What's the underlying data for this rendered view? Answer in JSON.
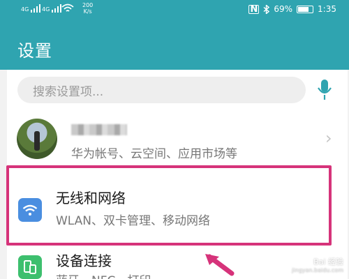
{
  "status_bar": {
    "sim1": "4G",
    "sim2": "4G",
    "speed_value": "200",
    "speed_unit": "K/s",
    "nfc": "N",
    "battery": "69%",
    "battery_level": 0.69,
    "time": "1:35",
    "icons": [
      "signal-icon",
      "signal-icon",
      "wifi-icon",
      "nfc-icon",
      "bluetooth-icon",
      "battery-icon"
    ]
  },
  "header": {
    "title": "设置"
  },
  "search": {
    "placeholder": "搜索设置项..."
  },
  "account": {
    "subtitle": "华为帐号、云空间、应用市场等"
  },
  "settings_items": [
    {
      "title": "无线和网络",
      "subtitle": "WLAN、双卡管理、移动网络",
      "icon": "wifi-icon",
      "icon_color": "#4a8ee0"
    },
    {
      "title": "设备连接",
      "subtitle": "蓝牙、NFC、打印",
      "icon": "device-link-icon",
      "icon_color": "#3dbf6e"
    }
  ],
  "colors": {
    "header": "#2fa4b0",
    "highlight": "#d6337a",
    "mic": "#2fa4b0"
  },
  "watermark": {
    "text": "Bai 经验",
    "sub": "jingyan.baidu.com"
  }
}
